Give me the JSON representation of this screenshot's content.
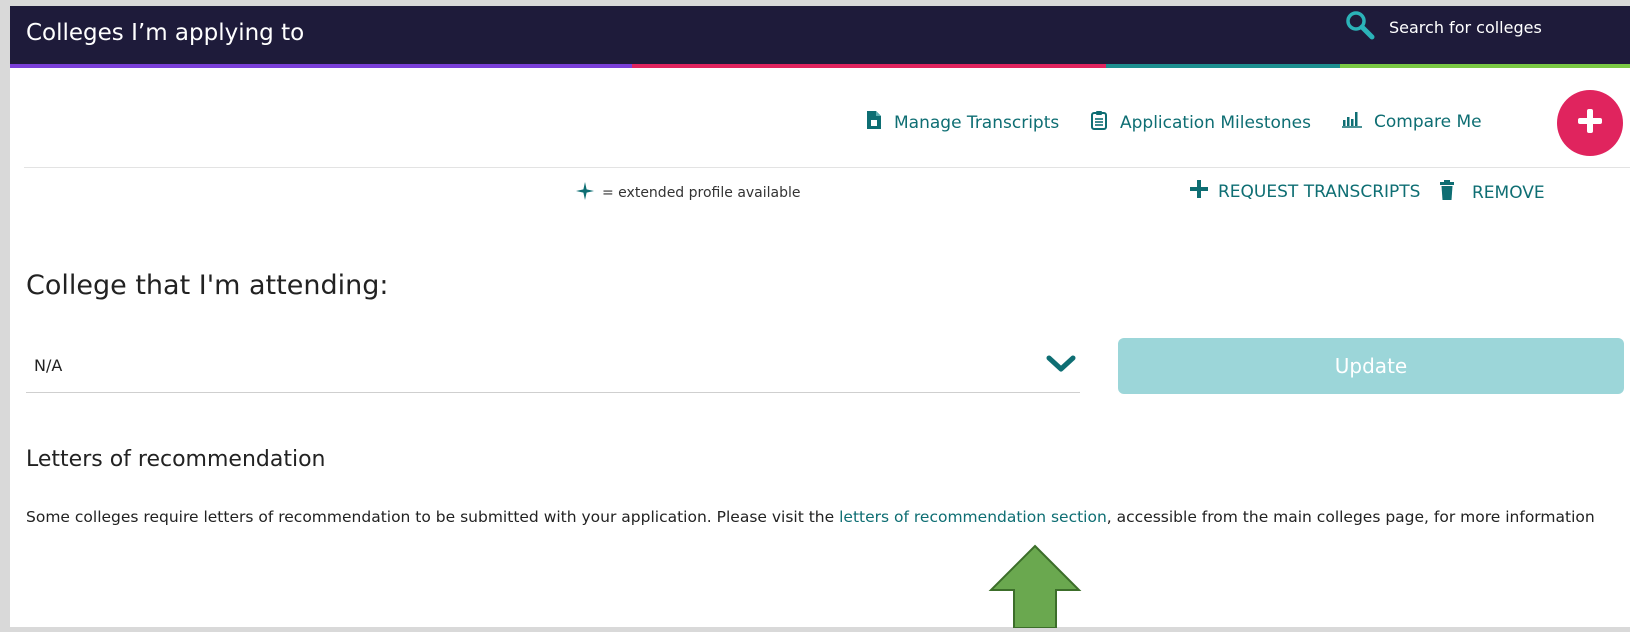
{
  "header": {
    "title": "Colleges I’m applying to",
    "search_label": "Search for colleges"
  },
  "stripes": [
    "#7a3fd8",
    "#e0245e",
    "#1d8f8f",
    "#7ac943"
  ],
  "actions": {
    "manage_transcripts": "Manage Transcripts",
    "application_milestones": "Application Milestones",
    "compare_me": "Compare Me"
  },
  "legend": {
    "text": "= extended profile available"
  },
  "list_actions": {
    "request_transcripts": "REQUEST TRANSCRIPTS",
    "remove": "REMOVE"
  },
  "attending": {
    "heading": "College that I'm attending:",
    "selected": "N/A",
    "update_label": "Update"
  },
  "letters": {
    "heading": "Letters of recommendation",
    "text_before": "Some colleges require letters of recommendation to be submitted with your application. Please visit the ",
    "link": "letters of recommendation section",
    "text_after": ", accessible from the main colleges page, for more information"
  },
  "colors": {
    "header_bg": "#1e1b3a",
    "accent_teal": "#0e6e73",
    "accent_pink": "#e0245e",
    "update_bg": "#9cd6d9",
    "arrow_green": "#6aa84f"
  }
}
